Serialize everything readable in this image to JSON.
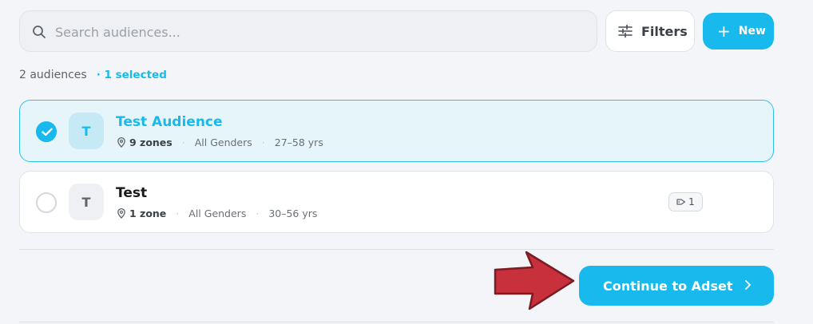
{
  "search": {
    "placeholder": "Search audiences..."
  },
  "toolbar": {
    "filters_label": "Filters",
    "new_label": "New",
    "new_icon": "plus-icon",
    "filters_icon": "sliders-icon"
  },
  "summary": {
    "count_text": "2 audiences",
    "selected_text": "· 1 selected"
  },
  "audiences": [
    {
      "avatar": "T",
      "name": "Test Audience",
      "zones": "9 zones",
      "gender": "All Genders",
      "age": "27–58 yrs",
      "selected": true
    },
    {
      "avatar": "T",
      "name": "Test",
      "zones": "1 zone",
      "gender": "All Genders",
      "age": "30–56 yrs",
      "selected": false,
      "tag_count": "1"
    }
  ],
  "footer": {
    "continue_label": "Continue to Adset",
    "continue_icon": "chevron-right-icon"
  },
  "colors": {
    "accent": "#18b9ec",
    "annotation_arrow": "#c8303c",
    "background": "#f4f5f8"
  }
}
